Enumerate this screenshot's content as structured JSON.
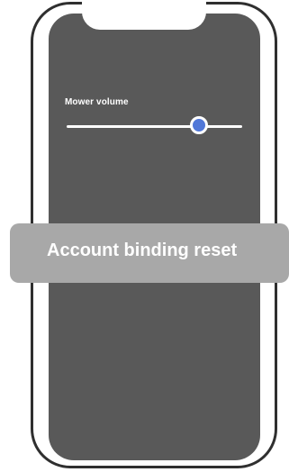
{
  "screen": {
    "slider": {
      "label": "Mower volume",
      "value_fraction": 0.755
    },
    "toast": {
      "message": "Account binding reset"
    }
  },
  "colors": {
    "screen_background": "#595959",
    "slider_thumb": "#5077d8",
    "toast_background": "#a8a8a8",
    "text": "#ffffff",
    "frame": "#2f2f2f"
  }
}
